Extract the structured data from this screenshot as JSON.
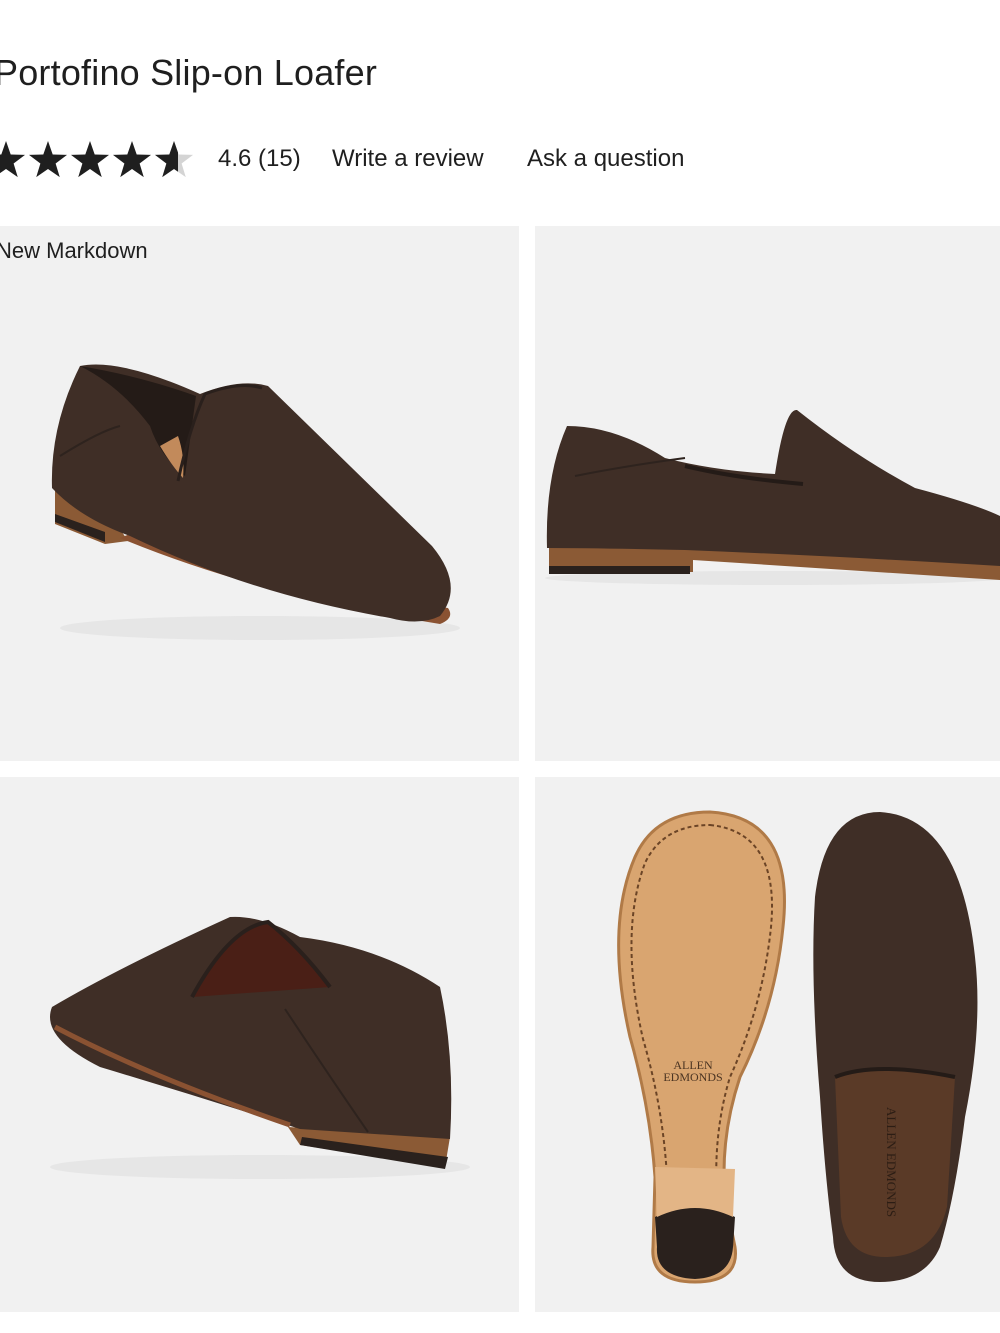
{
  "product": {
    "title": "Portofino Slip-on Loafer",
    "rating": {
      "value": 4.6,
      "max": 5,
      "summary": "4.6 (15)"
    },
    "actions": {
      "write_review": "Write a review",
      "ask_question": "Ask a question"
    },
    "gallery": {
      "badge": "New Markdown",
      "sole_brand": [
        "ALLEN",
        "EDMONDS"
      ],
      "insole_brand": "ALLEN EDMONDS"
    }
  },
  "colors": {
    "suede": "#3f2e26",
    "sole_leather": "#d9a570",
    "tile_bg": "#f1f1f1",
    "star": "#1f1f1f"
  }
}
